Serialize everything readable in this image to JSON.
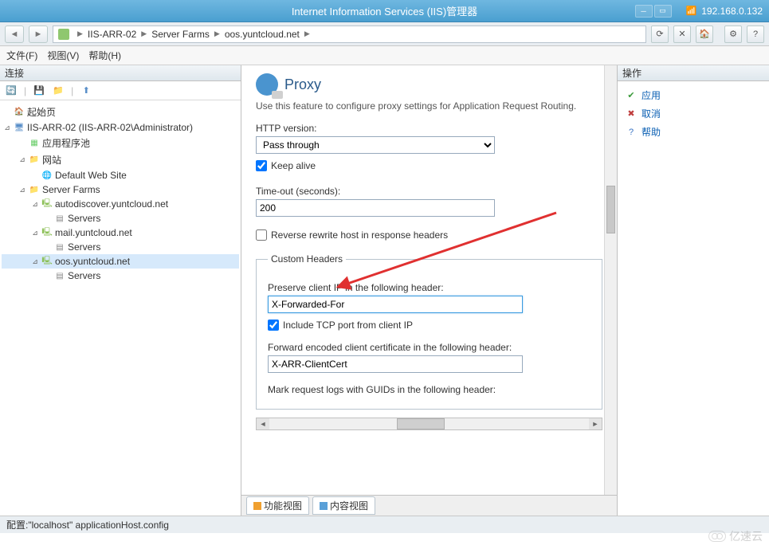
{
  "titlebar": {
    "title": "Internet Information Services (IIS)管理器",
    "ip": "192.168.0.132"
  },
  "breadcrumb": {
    "items": [
      "IIS-ARR-02",
      "Server Farms",
      "oos.yuntcloud.net"
    ]
  },
  "menubar": {
    "file": "文件(F)",
    "view": "视图(V)",
    "help": "帮助(H)"
  },
  "leftpanel": {
    "header": "连接"
  },
  "tree": {
    "home": "起始页",
    "server": "IIS-ARR-02 (IIS-ARR-02\\Administrator)",
    "apppool": "应用程序池",
    "sites": "网站",
    "default_site": "Default Web Site",
    "server_farms": "Server Farms",
    "farm1": "autodiscover.yuntcloud.net",
    "servers": "Servers",
    "farm2": "mail.yuntcloud.net",
    "farm3": "oos.yuntcloud.net"
  },
  "proxy": {
    "title": "Proxy",
    "intro": "Use this feature to configure proxy settings for Application Request Routing.",
    "http_version_label": "HTTP version:",
    "http_version_value": "Pass through",
    "keep_alive": "Keep alive",
    "timeout_label": "Time-out (seconds):",
    "timeout_value": "200",
    "reverse_rewrite": "Reverse rewrite host in response headers",
    "custom_headers_legend": "Custom Headers",
    "preserve_ip_label": "Preserve client IP in the following header:",
    "preserve_ip_value": "X-Forwarded-For",
    "include_tcp": "Include TCP port from client IP",
    "fwd_cert_label": "Forward encoded client certificate in the following header:",
    "fwd_cert_value": "X-ARR-ClientCert",
    "mark_logs_label": "Mark request logs with GUIDs in the following header:"
  },
  "tabs": {
    "features": "功能视图",
    "content": "内容视图"
  },
  "actions": {
    "header": "操作",
    "apply": "应用",
    "cancel": "取消",
    "help": "帮助"
  },
  "footer": {
    "config": "配置:\"localhost\" applicationHost.config"
  },
  "watermark": "亿速云"
}
